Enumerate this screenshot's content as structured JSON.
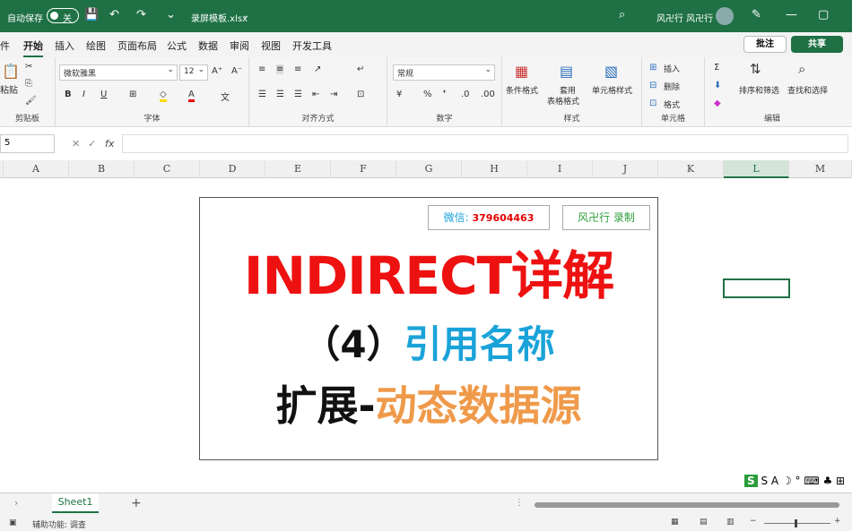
{
  "titlebar": {
    "autosave_label": "自动保存",
    "autosave_state": "关",
    "filename": "录屏模板.xlsx",
    "user": "风卍行 风卍行"
  },
  "menu": {
    "tabs": [
      "件",
      "开始",
      "插入",
      "绘图",
      "页面布局",
      "公式",
      "数据",
      "审阅",
      "视图",
      "开发工具"
    ],
    "comment_button": "批注",
    "share_button": "共享"
  },
  "ribbon": {
    "clipboard": {
      "paste": "粘贴",
      "label": "剪贴板"
    },
    "font": {
      "name": "微软雅黑",
      "size": "12",
      "label": "字体"
    },
    "alignment": {
      "label": "对齐方式"
    },
    "number": {
      "format": "常规",
      "label": "数字"
    },
    "styles": {
      "cond_format": "条件格式",
      "table_format_1": "套用",
      "table_format_2": "表格格式",
      "cell_style": "单元格样式",
      "label": "样式"
    },
    "cells": {
      "insert": "插入",
      "delete": "删除",
      "format": "格式",
      "label": "单元格"
    },
    "editing": {
      "sort_filter": "排序和筛选",
      "find_select": "查找和选择",
      "label": "编辑"
    }
  },
  "formula_bar": {
    "fx": "fx",
    "namebox": "5"
  },
  "columns": [
    "A",
    "B",
    "C",
    "D",
    "E",
    "F",
    "G",
    "H",
    "I",
    "J",
    "K",
    "L",
    "M"
  ],
  "card": {
    "wechat_label": "微信:",
    "wechat_number": "379604463",
    "recorder": "风卍行 录制",
    "title": "INDIRECT详解",
    "subtitle_num": "（4）",
    "subtitle_text": "引用名称",
    "line3_black": "扩展-",
    "line3_orange": "动态数据源"
  },
  "sheet": {
    "tab": "Sheet1",
    "add": "+"
  },
  "status": {
    "accessibility": "辅助功能: 调查"
  },
  "ime": {
    "icons": "S A ☽ ° ⌨ ♣ ⊞"
  }
}
